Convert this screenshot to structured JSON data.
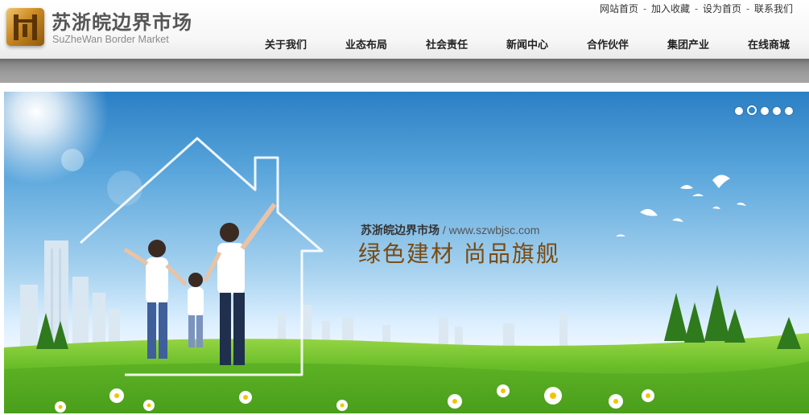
{
  "brand": {
    "title": "苏浙皖边界市场",
    "subtitle": "SuZheWan Border Market"
  },
  "top_links": [
    "网站首页",
    "加入收藏",
    "设为首页",
    "联系我们"
  ],
  "top_link_separator": " - ",
  "nav": [
    "关于我们",
    "业态布局",
    "社会责任",
    "新闻中心",
    "合作伙伴",
    "集团产业",
    "在线商城"
  ],
  "banner": {
    "company": "苏浙皖边界市场",
    "url": " / www.szwbjsc.com",
    "slogan": "绿色建材  尚品旗舰",
    "slide_count": 5,
    "active_slide": 2
  },
  "colors": {
    "slogan": "#7a4a10",
    "sky_top": "#2a7fc4",
    "grass": "#6bbf2a"
  }
}
